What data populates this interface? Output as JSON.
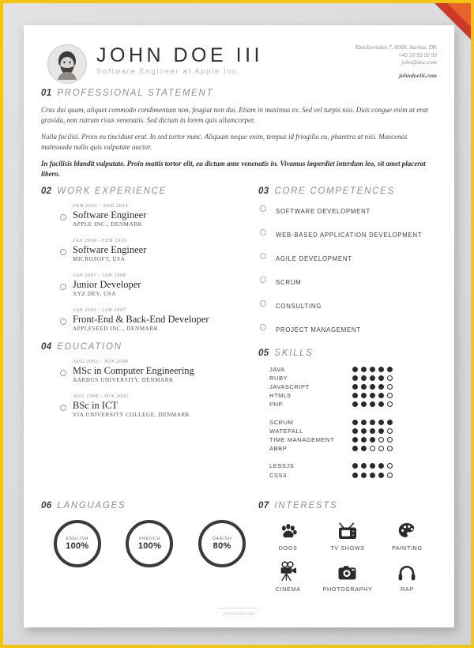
{
  "theme": {
    "border_color": "#f2c413",
    "ribbon_color": "#cf3a27",
    "ribbon_inner_color": "#e8622a",
    "paper_color": "#ffffff",
    "ink_color": "#2b2b2b",
    "muted_color": "#8e8e8e"
  },
  "header": {
    "name": "JOHN DOE III",
    "subtitle": "Software Engineer at Apple Inc.",
    "avatar_alt": "portrait-photo",
    "contact": {
      "address": "Åbnolsvenden 7, 8000, Aarhus, DK",
      "phone": "+45 50 93 02 93",
      "email": "john@doe.com",
      "website": "johndoeiii.com"
    }
  },
  "sections": {
    "statement": {
      "number": "01",
      "title": "PROFESSIONAL STATEMENT",
      "paragraphs": [
        "Cras dui quam, aliquet commodo condimentum non, feugiat non dui. Etiam in maximus ex. Sed vel turpis nisi. Duis congue enim at erat gravida, non rutrum risus venenatis. Sed dictum in lorem quis ullamcorper.",
        "Nulla facilisi. Proin eu tincidunt erat. In sed tortor nunc. Aliquam neque enim, tempus id fringilla eu, pharetra at nisi. Maecenas malesuada nulla quis vulputate auctor."
      ],
      "bold_paragraph": "In facilisis blandit vulputate. Proin mattis tortor elit, eu dictum ante venenatis in. Vivamus imperdiet interdum leo, sit amet placerat libero."
    },
    "work": {
      "number": "02",
      "title": "WORK EXPERIENCE",
      "entries": [
        {
          "date": "FEB 2010 - AUG 2014",
          "role": "Software Engineer",
          "org": "APPLE INC., DENMARK"
        },
        {
          "date": "JAN 2008 - FEB 2010",
          "role": "Software Engineer",
          "org": "MICROSOFT, USA"
        },
        {
          "date": "JAN 2007 - JAN 2008",
          "role": "Junior Developer",
          "org": "XYZ DEV, USA"
        },
        {
          "date": "JAN 2003 - JAN 2007",
          "role": "Front-End & Back-End Developer",
          "org": "APPLESEED INC., DENMARK"
        }
      ]
    },
    "education": {
      "number": "04",
      "title": "EDUCATION",
      "entries": [
        {
          "date": "AUG 2002 - JUN 2004",
          "role": "MSc in Computer Engineering",
          "org": "AARHUS UNIVERSITY, DENMARK"
        },
        {
          "date": "AUG 1998 - JUN 2002",
          "role": "BSc in ICT",
          "org": "VIA UNIVERSITY COLLEGE, DENMARK"
        }
      ]
    },
    "competences": {
      "number": "03",
      "title": "CORE COMPETENCES",
      "items": [
        "SOFTWARE DEVELOPMENT",
        "WEB-BASED APPLICATION DEVELOPMENT",
        "AGILE DEVELOPMENT",
        "SCRUM",
        "CONSULTING",
        "PROJECT MANAGEMENT"
      ]
    },
    "skills": {
      "number": "05",
      "title": "SKILLS",
      "max": 5,
      "groups": [
        {
          "items": [
            {
              "name": "JAVA",
              "rating": 5
            },
            {
              "name": "RUBY",
              "rating": 4
            },
            {
              "name": "JAVASCRIPT",
              "rating": 4
            },
            {
              "name": "HTML5",
              "rating": 4
            },
            {
              "name": "PHP",
              "rating": 4
            }
          ]
        },
        {
          "items": [
            {
              "name": "SCRUM",
              "rating": 5
            },
            {
              "name": "WATEFALL",
              "rating": 4
            },
            {
              "name": "TIME MANAGEMENT",
              "rating": 3
            },
            {
              "name": "ABBP",
              "rating": 2
            }
          ]
        },
        {
          "items": [
            {
              "name": "LESSJS",
              "rating": 4
            },
            {
              "name": "CSS3",
              "rating": 4
            }
          ]
        }
      ]
    },
    "languages": {
      "number": "06",
      "title": "LANGUAGES",
      "items": [
        {
          "name": "ENGLISH",
          "percent": "100%",
          "value": 100
        },
        {
          "name": "FRENCH",
          "percent": "100%",
          "value": 100
        },
        {
          "name": "DANISH",
          "percent": "80%",
          "value": 80
        }
      ]
    },
    "interests": {
      "number": "07",
      "title": "INTERESTS",
      "items": [
        {
          "label": "DOGS",
          "icon": "paw-icon"
        },
        {
          "label": "TV SHOWS",
          "icon": "television-icon"
        },
        {
          "label": "PAINTING",
          "icon": "palette-icon"
        },
        {
          "label": "CINEMA",
          "icon": "movie-camera-icon"
        },
        {
          "label": "PHOTOGRAPHY",
          "icon": "camera-icon"
        },
        {
          "label": "RAP",
          "icon": "headphones-icon"
        }
      ]
    }
  },
  "footer": {
    "text": "johndoeiii.com"
  },
  "watermark": {
    "text": ""
  }
}
